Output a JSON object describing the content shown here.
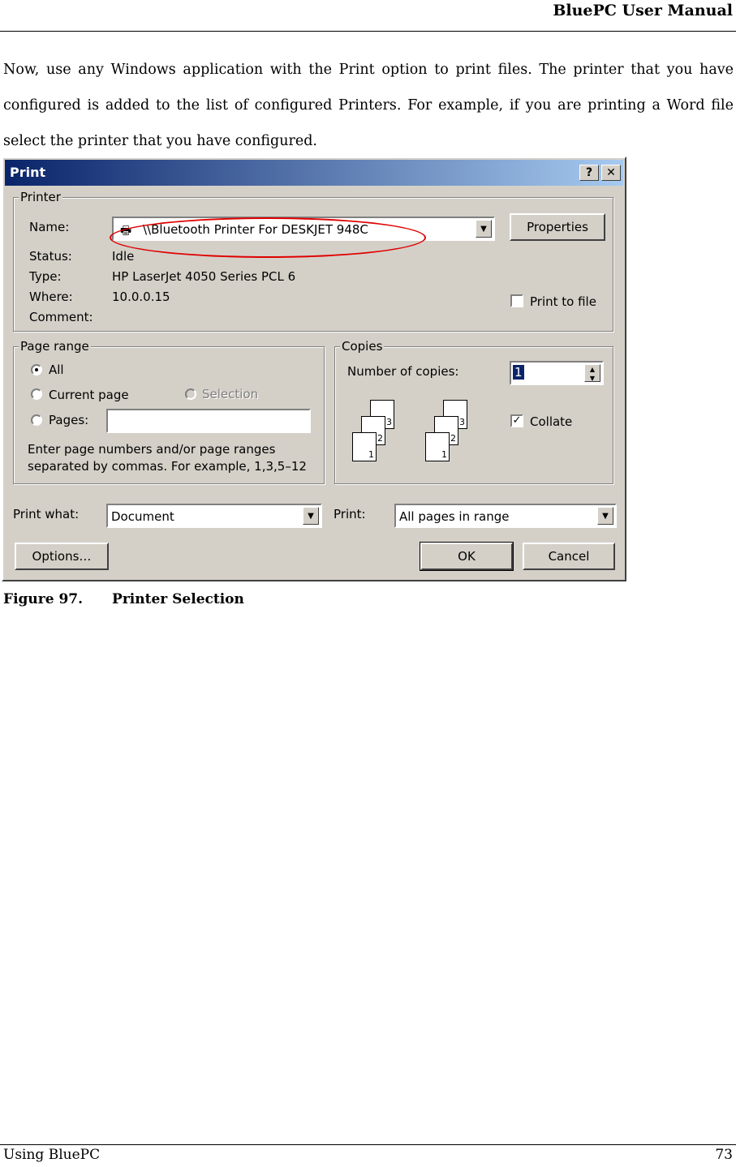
{
  "header": {
    "title": "BluePC User Manual"
  },
  "intro": "Now, use any Windows application with the Print option to print files. The printer that you have configured is added to the list of configured Printers. For example, if you are printing a Word file select the printer that you have configured.",
  "dialog": {
    "title": "Print",
    "help_button": "?",
    "close_button": "✕",
    "printer": {
      "legend": "Printer",
      "name_label": "Name:",
      "name_value": "\\\\Bluetooth Printer For DESKJET 948C",
      "properties_button": "Properties",
      "status_label": "Status:",
      "status_value": "Idle",
      "type_label": "Type:",
      "type_value": "HP LaserJet 4050 Series PCL 6",
      "where_label": "Where:",
      "where_value": "10.0.0.15",
      "comment_label": "Comment:",
      "print_to_file": "Print to file"
    },
    "page_range": {
      "legend": "Page range",
      "all": "All",
      "current_page": "Current page",
      "selection": "Selection",
      "pages": "Pages:",
      "hint_line1": "Enter page numbers and/or page ranges",
      "hint_line2": "separated by commas.  For example, 1,3,5–12"
    },
    "copies": {
      "legend": "Copies",
      "number_label": "Number of copies:",
      "number_value": "1",
      "collate": "Collate",
      "page_numbers": [
        "3",
        "2",
        "1"
      ]
    },
    "print_what_label": "Print what:",
    "print_what_value": "Document",
    "print_label": "Print:",
    "print_value": "All pages in range",
    "options_button": "Options…",
    "ok_button": "OK",
    "cancel_button": "Cancel"
  },
  "caption": {
    "number": "Figure 97.",
    "text": "Printer Selection"
  },
  "footer": {
    "left": "Using BluePC",
    "page": "73"
  }
}
